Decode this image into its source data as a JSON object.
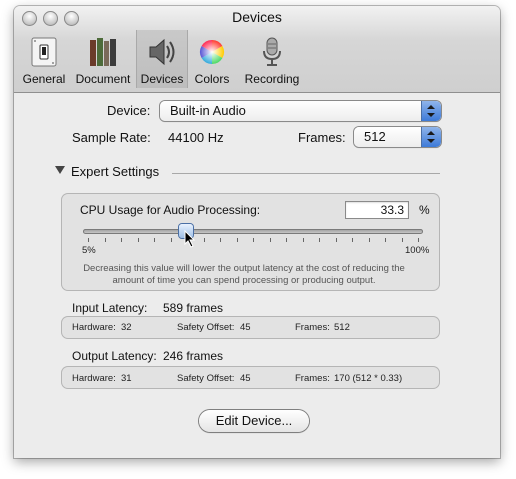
{
  "window": {
    "title": "Devices"
  },
  "toolbar": {
    "items": [
      {
        "label": "General",
        "icon": "switch-icon"
      },
      {
        "label": "Document",
        "icon": "books-icon"
      },
      {
        "label": "Devices",
        "icon": "speaker-icon",
        "selected": true
      },
      {
        "label": "Colors",
        "icon": "color-wheel-icon"
      },
      {
        "label": "Recording",
        "icon": "microphone-icon"
      }
    ]
  },
  "device": {
    "label": "Device:",
    "value": "Built-in Audio"
  },
  "sample_rate": {
    "label": "Sample Rate:",
    "value": "44100 Hz"
  },
  "frames": {
    "label": "Frames:",
    "value": "512"
  },
  "expert": {
    "title": "Expert Settings",
    "cpu_label": "CPU Usage for Audio Processing:",
    "cpu_value": "33.3",
    "cpu_unit": "%",
    "slider_min": "5%",
    "slider_max": "100%",
    "slider_value_percent": 33.3,
    "hint": "Decreasing this value will lower the output latency at the cost of reducing the amount of time you can spend processing or producing output."
  },
  "input_latency": {
    "label": "Input Latency:",
    "value": "589 frames",
    "hardware_label": "Hardware:",
    "hardware": "32",
    "safety_label": "Safety Offset:",
    "safety": "45",
    "frames_label": "Frames:",
    "frames": "512"
  },
  "output_latency": {
    "label": "Output Latency:",
    "value": "246 frames",
    "hardware_label": "Hardware:",
    "hardware": "31",
    "safety_label": "Safety Offset:",
    "safety": "45",
    "frames_label": "Frames:",
    "frames": "170 (512 * 0.33)"
  },
  "edit_button": {
    "label": "Edit Device..."
  },
  "colors": {
    "accent": "#3d7ad8",
    "window_bg": "#ececec"
  }
}
